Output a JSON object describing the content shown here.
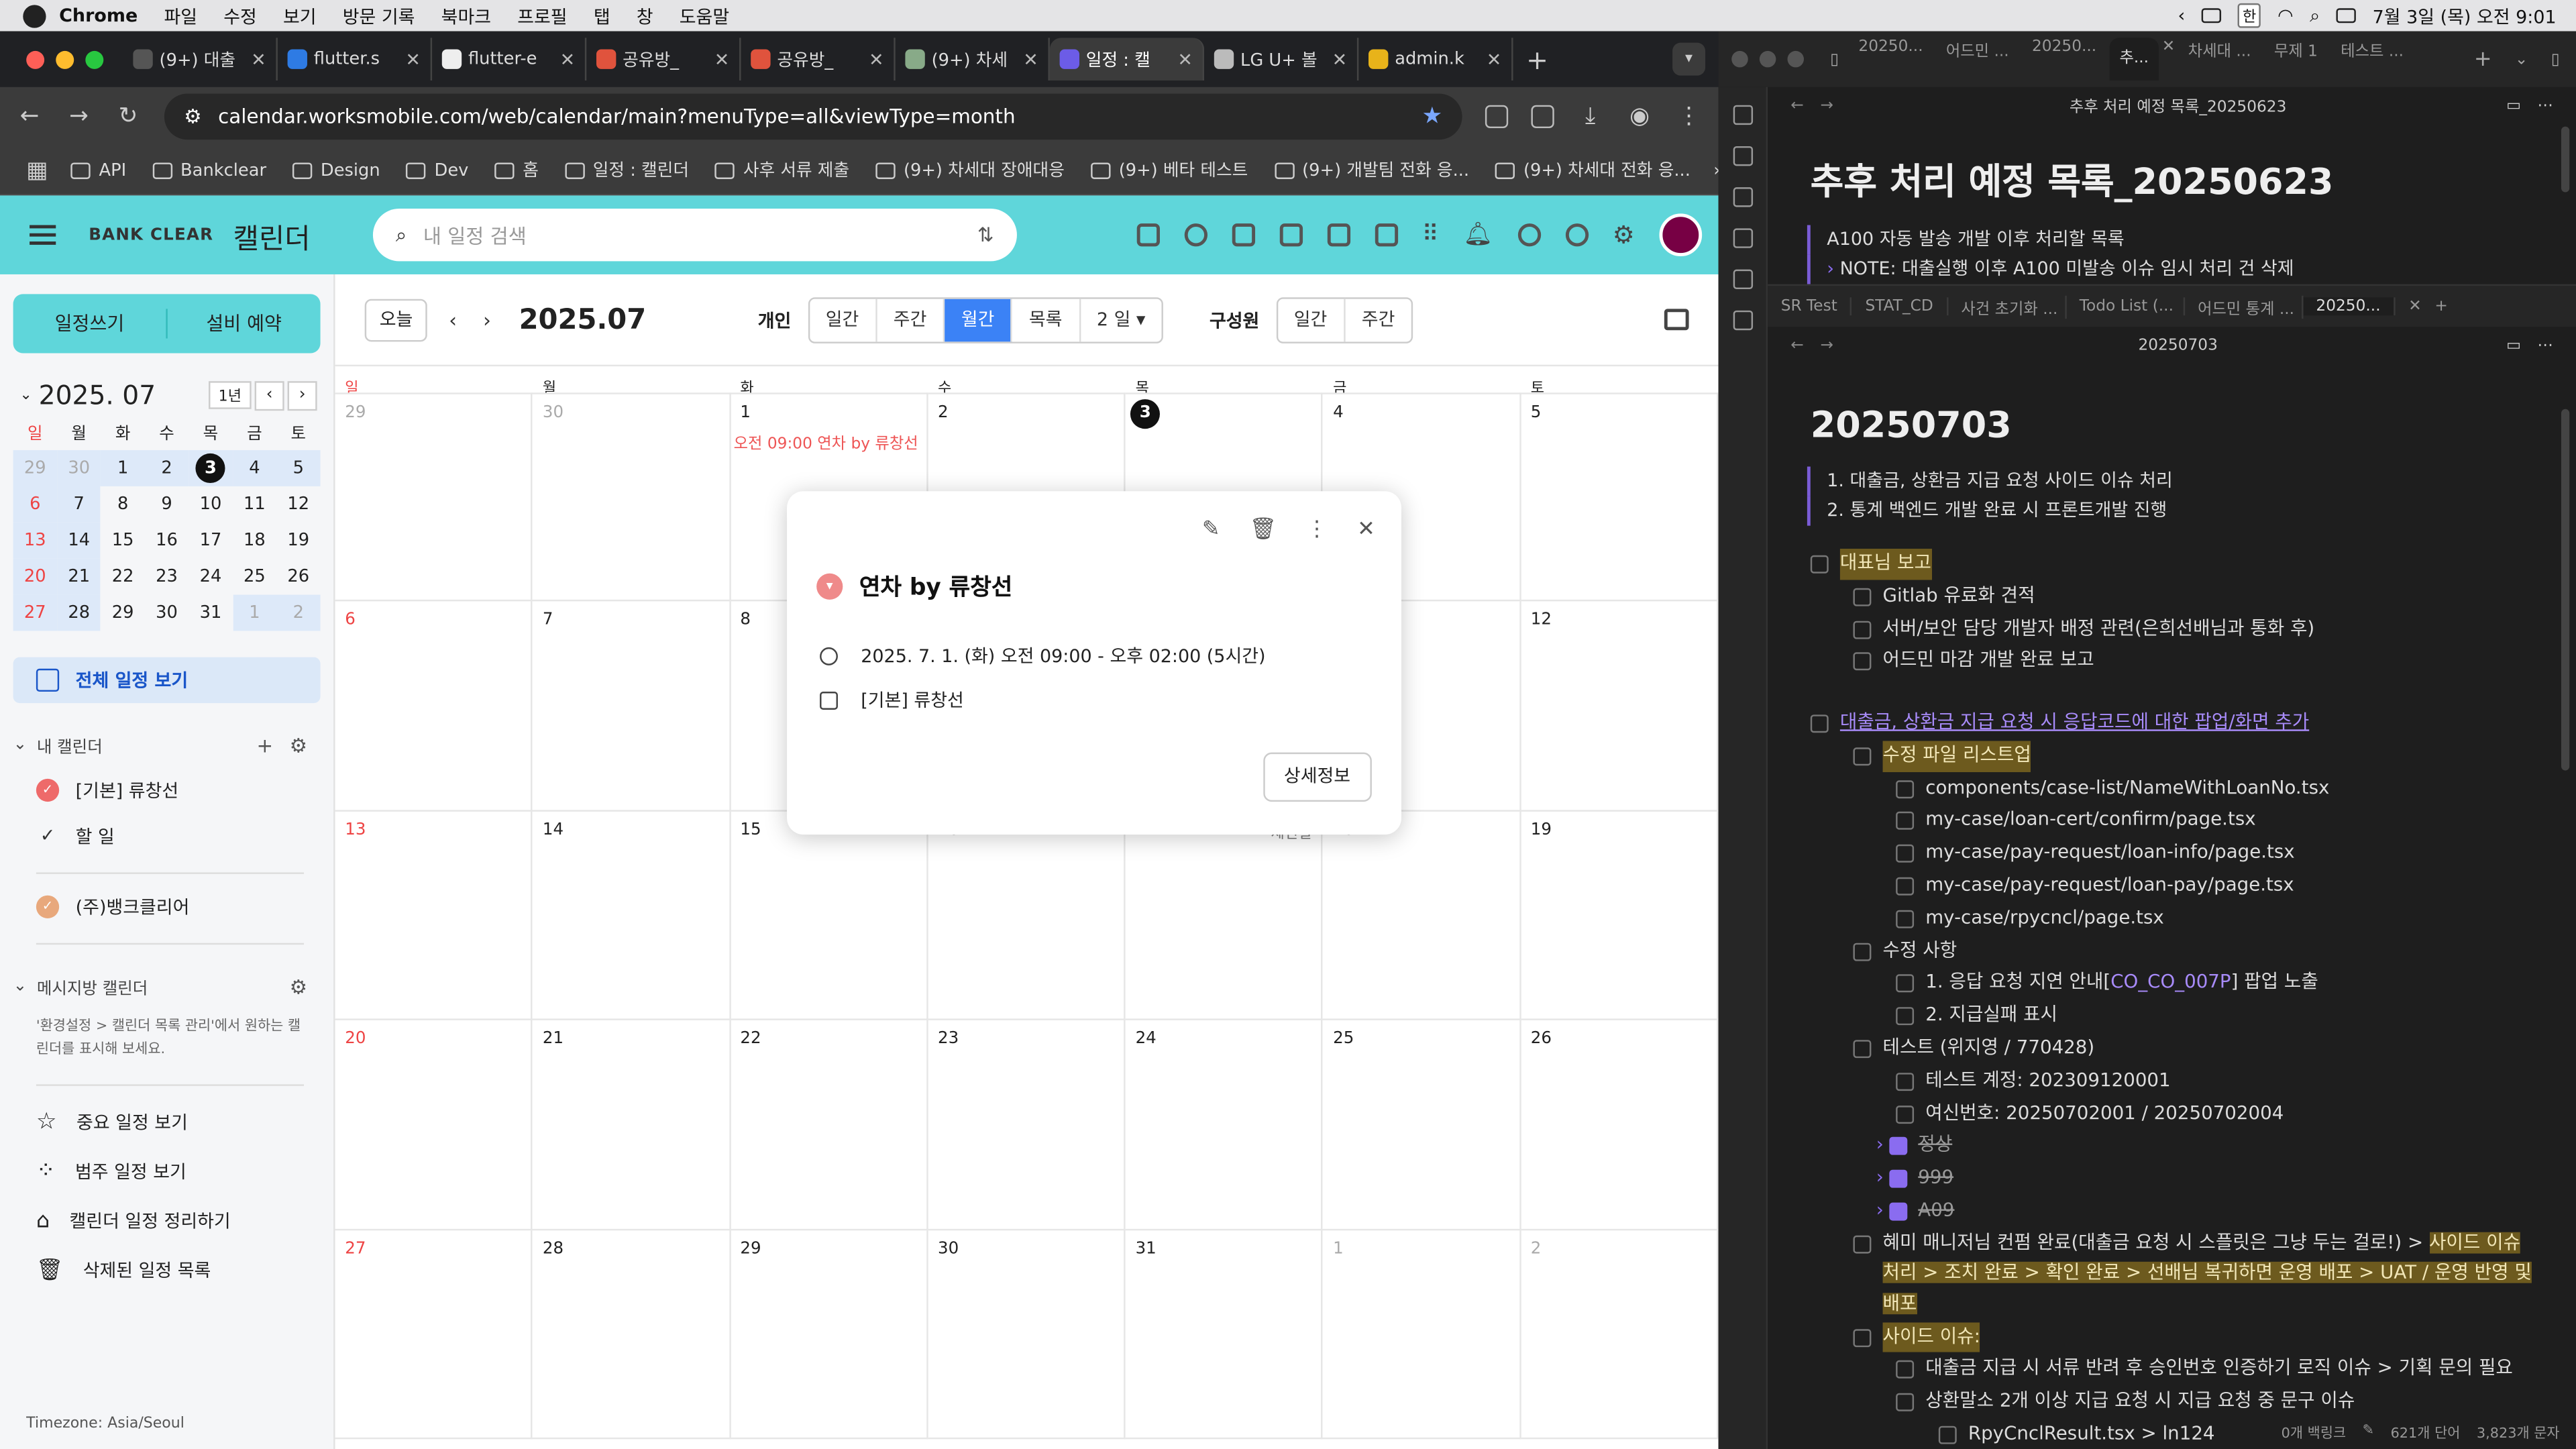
{
  "menubar": {
    "app": "Chrome",
    "items": [
      "파일",
      "수정",
      "보기",
      "방문 기록",
      "북마크",
      "프로필",
      "탭",
      "창",
      "도움말"
    ],
    "clock": "7월 3일 (목) 오전 9:01",
    "ime": "한"
  },
  "chrome": {
    "tabs": [
      {
        "label": "(9+) 대출",
        "color": "#555"
      },
      {
        "label": "flutter.s",
        "color": "#2e7be4"
      },
      {
        "label": "flutter-e",
        "color": "#eee"
      },
      {
        "label": "공유방_",
        "color": "#e0533d"
      },
      {
        "label": "공유방_",
        "color": "#e0533d"
      },
      {
        "label": "(9+) 차세",
        "color": "#8a8"
      },
      {
        "label": "일정 : 캘",
        "color": "#6c5ce7"
      },
      {
        "label": "LG U+ 볼",
        "color": "#bbb"
      },
      {
        "label": "admin.k",
        "color": "#e8b31a"
      }
    ],
    "url": "calendar.worksmobile.com/web/calendar/main?menuType=all&viewType=month",
    "bookmarks": [
      "API",
      "Bankclear",
      "Design",
      "Dev",
      "홈",
      "일정 : 캘린더",
      "사후 서류 제출",
      "(9+) 차세대 장애대응",
      "(9+) 베타 테스트",
      "(9+) 개발팀 전화 응...",
      "(9+) 차세대 전화 응..."
    ]
  },
  "app": {
    "logo": "BANK CLEAR",
    "title": "캘린더",
    "search_placeholder": "내 일정 검색"
  },
  "left": {
    "btn_write": "일정쓰기",
    "btn_facility": "설비 예약",
    "mini_title": "2025. 07",
    "mini_range": "1년",
    "dow": [
      "일",
      "월",
      "화",
      "수",
      "목",
      "금",
      "토"
    ],
    "weeks": [
      [
        "29",
        "30",
        "1",
        "2",
        "3",
        "4",
        "5"
      ],
      [
        "6",
        "7",
        "8",
        "9",
        "10",
        "11",
        "12"
      ],
      [
        "13",
        "14",
        "15",
        "16",
        "17",
        "18",
        "19"
      ],
      [
        "20",
        "21",
        "22",
        "23",
        "24",
        "25",
        "26"
      ],
      [
        "27",
        "28",
        "29",
        "30",
        "31",
        "1",
        "2"
      ]
    ],
    "all_view": "전체 일정 보기",
    "my_cal_title": "내 캘린더",
    "my_cals": [
      "[기본] 류창선",
      "할 일",
      "(주)뱅크클리어"
    ],
    "messenger_title": "메시지방 캘린더",
    "messenger_note": "'환경설정 > 캘린더 목록 관리'에서 원하는 캘린더를 표시해 보세요.",
    "nav": [
      "중요 일정 보기",
      "범주 일정 보기",
      "캘린더 일정 정리하기",
      "삭제된 일정 목록"
    ],
    "timezone": "Timezone: Asia/Seoul"
  },
  "main": {
    "today": "오늘",
    "period": "2025.07",
    "personal": "개인",
    "views": [
      "일간",
      "주간",
      "월간",
      "목록",
      "2 일 ▾"
    ],
    "member": "구성원",
    "member_views": [
      "일간",
      "주간"
    ],
    "dow": [
      "일",
      "월",
      "화",
      "수",
      "목",
      "금",
      "토"
    ],
    "weeks": [
      [
        "29",
        "30",
        "1",
        "2",
        "3",
        "4",
        "5"
      ],
      [
        "6",
        "7",
        "8",
        "9",
        "10",
        "11",
        "12"
      ],
      [
        "13",
        "14",
        "15",
        "16",
        "17",
        "18",
        "19"
      ],
      [
        "20",
        "21",
        "22",
        "23",
        "24",
        "25",
        "26"
      ],
      [
        "27",
        "28",
        "29",
        "30",
        "31",
        "1",
        "2"
      ]
    ],
    "holiday": "제헌절",
    "event": "오전 09:00 연차 by 류창선"
  },
  "popup": {
    "title": "연차 by 류창선",
    "datetime": "2025. 7. 1. (화) 오전 09:00 - 오후 02:00 (5시간)",
    "calendar": "[기본] 류창선",
    "detail": "상세정보"
  },
  "obsidian": {
    "top_tabs": [
      "20250...",
      "어드민 ...",
      "20250...",
      "추...",
      "차세대 ...",
      "무제 1",
      "테스트 ..."
    ],
    "pane1_title": "추후 처리 예정 목록_20250623",
    "pane1_h1": "추후 처리 예정 목록_20250623",
    "pane1_lines": [
      "A100 자동 발송 개발 이후 처리할 목록",
      "NOTE: 대출실행 이후 A100 미발송 이슈 임시 처리 건 삭제"
    ],
    "tabs2": [
      "SR Test",
      "STAT_CD",
      "사건 초기화 ...",
      "Todo List (...",
      "어드민 통계 ...",
      "20250..."
    ],
    "pane2_title": "20250703",
    "pane2_h1": "20250703",
    "ordered": [
      "1. 대출금, 상환금 지급 요청 사이드 이슈 처리",
      "2. 통계 백엔드 개발 완료 시 프론트개발 진행"
    ],
    "tasks": [
      {
        "t": "대표님 보고",
        "lvl": 0,
        "hl": true
      },
      {
        "t": "Gitlab 유료화 견적",
        "lvl": 1
      },
      {
        "t": "서버/보안 담당 개발자 배정 관련(은희선배님과 통화 후)",
        "lvl": 1
      },
      {
        "t": "어드민 마감 개발 완료 보고",
        "lvl": 1
      },
      {
        "t": "",
        "lvl": -1
      },
      {
        "t": "대출금, 상환금 지급 요청 시 응답코드에 대한 팝업/화면 추가",
        "lvl": 0,
        "link": true
      },
      {
        "t": "수정 파일 리스트업",
        "lvl": 1,
        "hl": true
      },
      {
        "t": "components/case-list/NameWithLoanNo.tsx",
        "lvl": 2
      },
      {
        "t": "my-case/loan-cert/confirm/page.tsx",
        "lvl": 2
      },
      {
        "t": "my-case/pay-request/loan-info/page.tsx",
        "lvl": 2
      },
      {
        "t": "my-case/pay-request/loan-pay/page.tsx",
        "lvl": 2
      },
      {
        "t": "my-case/rpycncl/page.tsx",
        "lvl": 2
      },
      {
        "t": "수정 사항",
        "lvl": 1
      },
      {
        "t": "1. 응답 요청 지연 안내[CO_CO_007P] 팝업 노출",
        "lvl": 2
      },
      {
        "t": "2. 지급실패 표시",
        "lvl": 2
      },
      {
        "t": "테스트 (위지영 / 770428)",
        "lvl": 1
      },
      {
        "t": "테스트 계정: 202309120001",
        "lvl": 2
      },
      {
        "t": "여신번호: 20250702001 / 20250702004",
        "lvl": 2
      },
      {
        "t": "정상",
        "lvl": 2,
        "done": true
      },
      {
        "t": "999",
        "lvl": 2,
        "done": true
      },
      {
        "t": "A09",
        "lvl": 2,
        "done": true
      },
      {
        "t": "혜미 매니저님 컨펌 완료(대출금 요청 시 스플릿은 그냥 두는 걸로!) > 사이드 이슈 처리 > 조치 완료 > 확인 완료 > 선배님 복귀하면 운영 배포 > UAT / 운영 반영 및 배포",
        "lvl": 1,
        "hlTail": true
      },
      {
        "t": "사이드 이슈:",
        "lvl": 1,
        "hl": true
      },
      {
        "t": "대출금 지급 시 서류 반려 후 승인번호 인증하기 로직 이슈 > 기획 문의 필요",
        "lvl": 2
      },
      {
        "t": "상환말소 2개 이상 지급 요청 시 지급 요청 중 문구 이슈",
        "lvl": 2
      },
      {
        "t": "RpyCnclResult.tsx > ln124",
        "lvl": 3
      }
    ],
    "status": [
      "0개 백링크",
      "621개 단어",
      "3,823개 문자"
    ]
  }
}
